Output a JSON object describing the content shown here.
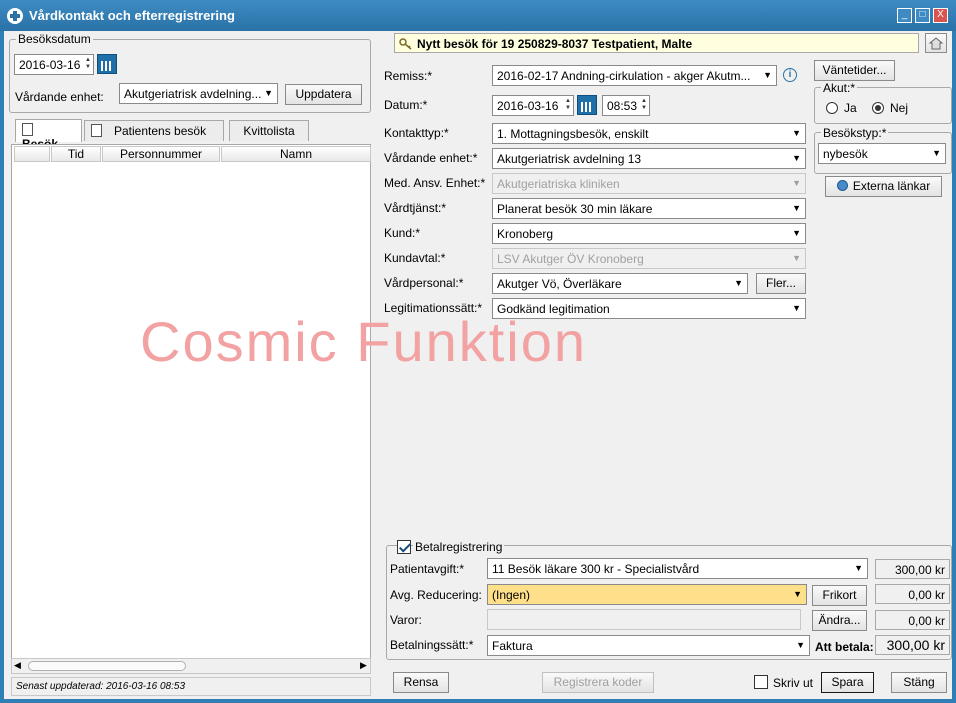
{
  "window": {
    "title": "Vårdkontakt och efterregistrering",
    "controls": [
      "_",
      "□",
      "X"
    ]
  },
  "left": {
    "date_group_label": "Besöksdatum",
    "date_value": "2016-03-16",
    "unit_label": "Vårdande enhet:",
    "unit_value": "Akutgeriatrisk avdelning...",
    "update_button": "Uppdatera",
    "tabs": [
      {
        "label": "Besök",
        "active": true
      },
      {
        "label": "Patientens besök",
        "active": false
      },
      {
        "label": "Kvittolista",
        "active": false
      }
    ],
    "columns": [
      "",
      "Tid",
      "Personnummer",
      "Namn"
    ],
    "status_text": "Senast uppdaterad: 2016-03-16 08:53"
  },
  "right": {
    "banner": "Nytt besök för 19 250829-8037 Testpatient, Malte",
    "fields": {
      "remiss_label": "Remiss:*",
      "remiss_value": "2016-02-17 Andning-cirkulation - akger Akutm...",
      "datum_label": "Datum:*",
      "datum_value": "2016-03-16",
      "time_value": "08:53",
      "kontakttyp_label": "Kontakttyp:*",
      "kontakttyp_value": "1.  Mottagningsbesök, enskilt",
      "vardande_label": "Vårdande enhet:*",
      "vardande_value": "Akutgeriatrisk avdelning 13",
      "medansv_label": "Med. Ansv. Enhet:*",
      "medansv_value": "Akutgeriatriska kliniken",
      "vardtjanst_label": "Vårdtjänst:*",
      "vardtjanst_value": "Planerat besök 30 min läkare",
      "kund_label": "Kund:*",
      "kund_value": "Kronoberg",
      "kundavtal_label": "Kundavtal:*",
      "kundavtal_value": "LSV Akutger ÖV Kronoberg",
      "vardpersonal_label": "Vårdpersonal:*",
      "vardpersonal_value": "Akutger Vö, Överläkare",
      "fler_button": "Fler...",
      "legitimation_label": "Legitimationssätt:*",
      "legitimation_value": "Godkänd legitimation"
    },
    "side": {
      "vantetider_button": "Väntetider...",
      "akut_label": "Akut:*",
      "akut_ja": "Ja",
      "akut_nej": "Nej",
      "akut_selected": "Nej",
      "besokstyp_label": "Besökstyp:*",
      "besokstyp_value": "nybesök",
      "externa_button": "Externa länkar"
    },
    "watermark": "Cosmic Funktion",
    "payment": {
      "group_label": "Betalregistrering",
      "checked": true,
      "patientavgift_label": "Patientavgift:*",
      "patientavgift_value": "11 Besök läkare 300 kr  - Specialistvård",
      "patientavgift_amount": "300,00 kr",
      "reducering_label": "Avg. Reducering:",
      "reducering_value": "(Ingen)",
      "frikort_button": "Frikort",
      "reducering_amount": "0,00 kr",
      "varor_label": "Varor:",
      "andra_button": "Ändra...",
      "varor_amount": "0,00 kr",
      "betalningssatt_label": "Betalningssätt:*",
      "betalningssatt_value": "Faktura",
      "att_betala_label": "Att betala:",
      "att_betala_amount": "300,00 kr"
    },
    "footer": {
      "rensa_button": "Rensa",
      "registrera_button": "Registrera koder",
      "skriv_ut_label": "Skriv ut",
      "spara_button": "Spara",
      "stang_button": "Stäng"
    }
  },
  "colors": {
    "title_bar": "#2a72a8",
    "watermark": "#f2a2a2",
    "highlight_field": "#ffe08a",
    "banner_bg": "#ffffe0"
  }
}
